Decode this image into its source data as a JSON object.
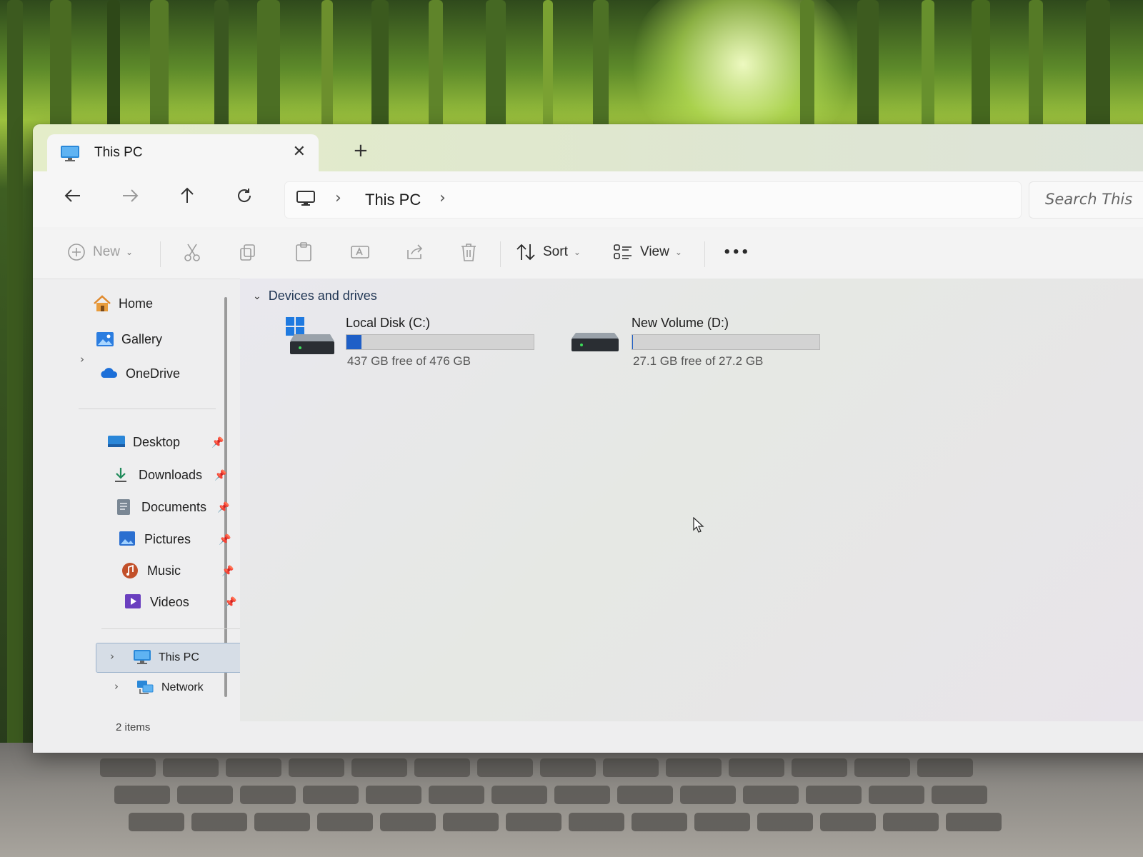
{
  "window": {
    "tab_title": "This PC",
    "tab_close_glyph": "✕",
    "new_tab_glyph": "+"
  },
  "navigation": {
    "back_icon": "arrow-left-icon",
    "forward_icon": "arrow-right-icon",
    "up_icon": "arrow-up-icon",
    "refresh_icon": "refresh-icon"
  },
  "address": {
    "breadcrumbs": [
      "This PC"
    ],
    "search_placeholder": "Search This"
  },
  "toolbar": {
    "new_label": "New",
    "sort_label": "Sort",
    "view_label": "View",
    "more_glyph": "•••"
  },
  "sidebar": {
    "top_items": [
      {
        "label": "Home",
        "icon": "home-icon"
      },
      {
        "label": "Gallery",
        "icon": "gallery-icon"
      },
      {
        "label": "OneDrive",
        "icon": "onedrive-icon"
      }
    ],
    "quick_access": [
      {
        "label": "Desktop",
        "icon": "desktop-folder-icon",
        "pinned": true
      },
      {
        "label": "Downloads",
        "icon": "downloads-icon",
        "pinned": true
      },
      {
        "label": "Documents",
        "icon": "documents-icon",
        "pinned": true
      },
      {
        "label": "Pictures",
        "icon": "pictures-icon",
        "pinned": true
      },
      {
        "label": "Music",
        "icon": "music-icon",
        "pinned": true
      },
      {
        "label": "Videos",
        "icon": "videos-icon",
        "pinned": true
      }
    ],
    "bottom_items": [
      {
        "label": "This PC",
        "icon": "this-pc-icon",
        "selected": true
      },
      {
        "label": "Network",
        "icon": "network-icon",
        "selected": false
      }
    ]
  },
  "content": {
    "section_title": "Devices and drives",
    "drives": [
      {
        "name": "Local Disk (C:)",
        "free_text": "437 GB free of 476 GB",
        "used_fraction": 0.082,
        "icon": "windows-drive-icon"
      },
      {
        "name": "New Volume (D:)",
        "free_text": "27.1 GB free of 27.2 GB",
        "used_fraction": 0.004,
        "icon": "drive-icon"
      }
    ]
  },
  "status": {
    "item_count": "2 items"
  },
  "colors": {
    "accent": "#1f5fc7",
    "selection": "#d6dde6"
  }
}
